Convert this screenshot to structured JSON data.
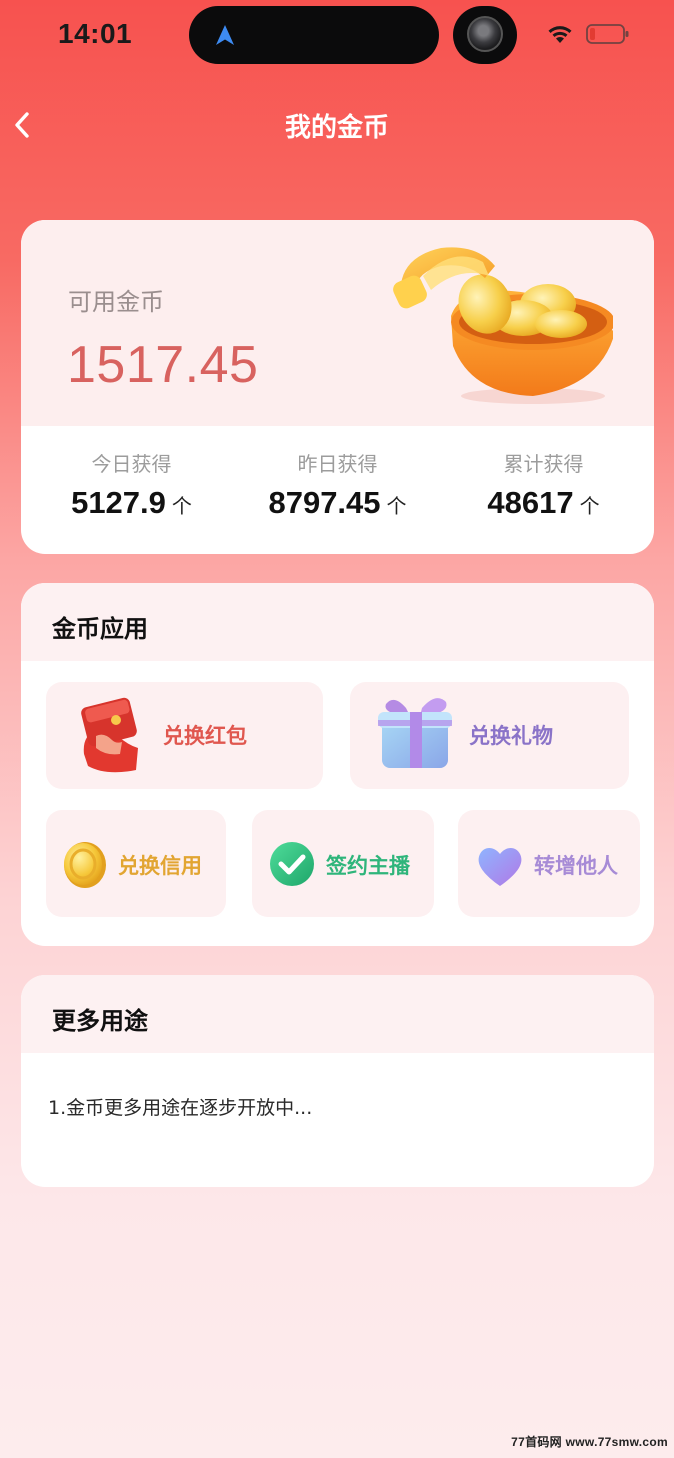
{
  "status_bar": {
    "time": "14:01"
  },
  "header": {
    "title": "我的金币"
  },
  "balance": {
    "label": "可用金币",
    "value": "1517.45",
    "stats": [
      {
        "label": "今日获得",
        "value": "5127.9",
        "unit": "个"
      },
      {
        "label": "昨日获得",
        "value": "8797.45",
        "unit": "个"
      },
      {
        "label": "累计获得",
        "value": "48617",
        "unit": "个"
      }
    ]
  },
  "apps": {
    "heading": "金币应用",
    "items": [
      {
        "label": "兑换红包",
        "icon": "red-envelope-icon",
        "color": "#e0574f"
      },
      {
        "label": "兑换礼物",
        "icon": "gift-box-icon",
        "color": "#8a73c8"
      },
      {
        "label": "兑换信用",
        "icon": "gold-coin-icon",
        "color": "#e2a532"
      },
      {
        "label": "签约主播",
        "icon": "green-check-icon",
        "color": "#2fb57b"
      },
      {
        "label": "转增他人",
        "icon": "heart-icon",
        "color": "#a78bd6"
      }
    ]
  },
  "more": {
    "heading": "更多用途",
    "text": "1.金币更多用途在逐步开放中..."
  },
  "watermark": "77首码网 www.77smw.com"
}
